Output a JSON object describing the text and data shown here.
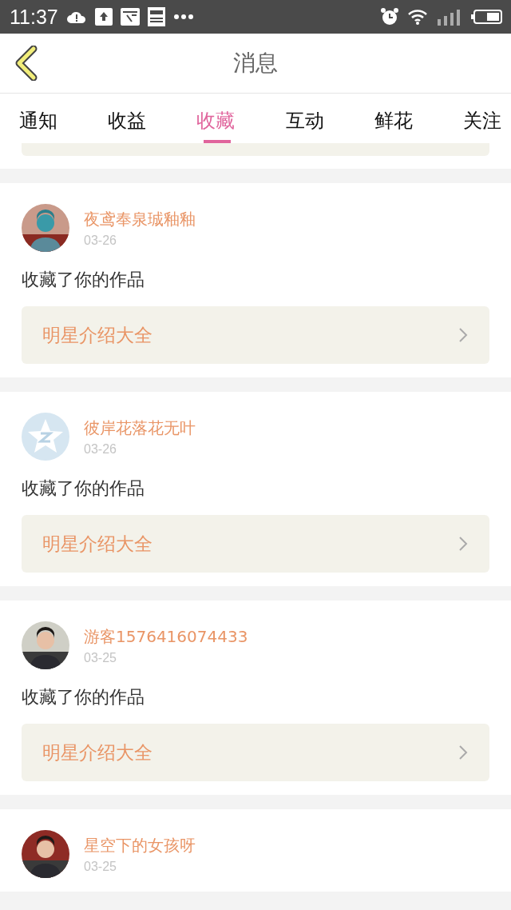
{
  "status_bar": {
    "time": "11:37"
  },
  "header": {
    "title": "消息"
  },
  "tabs": [
    {
      "label": "通知",
      "selected": false
    },
    {
      "label": "收益",
      "selected": false
    },
    {
      "label": "收藏",
      "selected": true
    },
    {
      "label": "互动",
      "selected": false
    },
    {
      "label": "鲜花",
      "selected": false
    },
    {
      "label": "关注",
      "selected": false
    }
  ],
  "messages": [
    {
      "name": "夜鸢奉泉珹釉釉",
      "date": "03-26",
      "action": "收藏了你的作品",
      "work": "明星介绍大全"
    },
    {
      "avatar": {
        "kind": "default"
      },
      "name": "彼岸花落花无叶",
      "date": "03-26",
      "action": "收藏了你的作品",
      "work": "明星介绍大全"
    },
    {
      "name": "游客1576416074433",
      "date": "03-25",
      "action": "收藏了你的作品",
      "work": "明星介绍大全"
    },
    {
      "name": "星空下的女孩呀",
      "date": "03-25"
    }
  ]
}
